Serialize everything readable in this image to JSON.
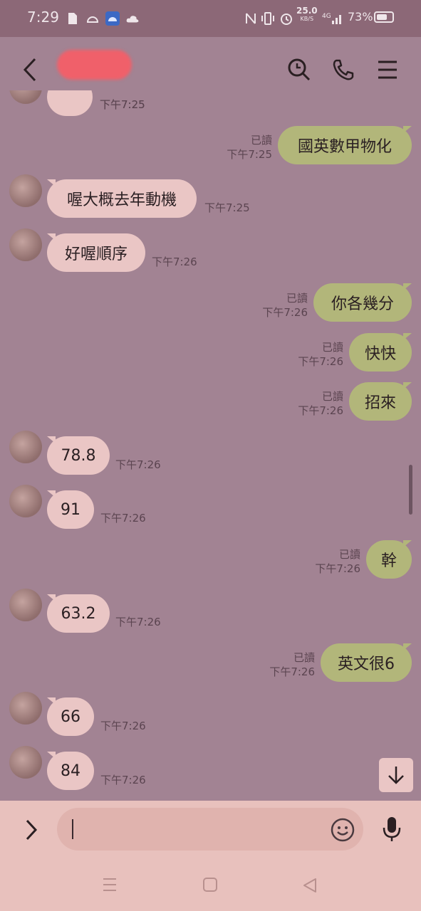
{
  "status_bar": {
    "time": "7:29",
    "net_speed": "25.0",
    "net_unit": "KB/S",
    "network_type": "4G",
    "battery": "73%"
  },
  "header": {
    "contact_name_redacted": true
  },
  "messages": [
    {
      "dir": "in",
      "text": "",
      "time": "下午7:25"
    },
    {
      "dir": "out",
      "text": "國英數甲物化",
      "time": "下午7:25",
      "read": "已讀"
    },
    {
      "dir": "in",
      "text": "喔大概去年動機",
      "time": "下午7:25"
    },
    {
      "dir": "in",
      "text": "好喔順序",
      "time": "下午7:26"
    },
    {
      "dir": "out",
      "text": "你各幾分",
      "time": "下午7:26",
      "read": "已讀"
    },
    {
      "dir": "out",
      "text": "快快",
      "time": "下午7:26",
      "read": "已讀"
    },
    {
      "dir": "out",
      "text": "招來",
      "time": "下午7:26",
      "read": "已讀"
    },
    {
      "dir": "in",
      "text": "78.8",
      "time": "下午7:26"
    },
    {
      "dir": "in",
      "text": "91",
      "time": "下午7:26"
    },
    {
      "dir": "out",
      "text": "幹",
      "time": "下午7:26",
      "read": "已讀"
    },
    {
      "dir": "in",
      "text": "63.2",
      "time": "下午7:26"
    },
    {
      "dir": "out",
      "text": "英文很6",
      "time": "下午7:26",
      "read": "已讀"
    },
    {
      "dir": "in",
      "text": "66",
      "time": "下午7:26"
    },
    {
      "dir": "in",
      "text": "84",
      "time": "下午7:26"
    }
  ],
  "input": {
    "value": ""
  },
  "colors": {
    "background": "#a28393",
    "incoming_bubble": "#eac6c5",
    "outgoing_bubble": "#b2b67a",
    "input_bar": "#e8c1bd",
    "status_bar": "#8c6877"
  },
  "icons": [
    "back-icon",
    "search-icon",
    "phone-icon",
    "menu-icon",
    "expand-icon",
    "emoji-icon",
    "mic-icon",
    "scroll-down-icon",
    "nav-recents-icon",
    "nav-home-icon",
    "nav-back-icon"
  ]
}
